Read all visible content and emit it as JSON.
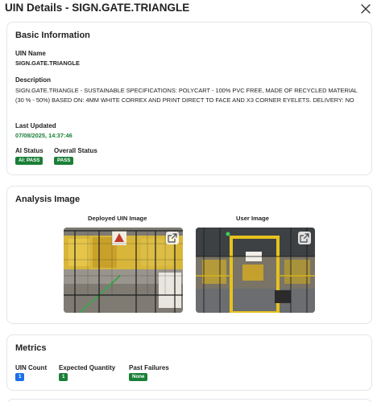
{
  "header": {
    "title": "UIN Details - SIGN.GATE.TRIANGLE"
  },
  "basic_info": {
    "title": "Basic Information",
    "uin_name_label": "UIN Name",
    "uin_name_value": "SIGN.GATE.TRIANGLE",
    "description_label": "Description",
    "description_value": "SIGN.GATE.TRIANGLE - SUSTAINABLE SPECIFICATIONS: POLYCART - 100% PVC FREE, MADE OF RECYCLED MATERIAL (30 % - 50%) BASED ON: 4MM WHITE CORREX AND PRINT DIRECT TO FACE AND X3 CORNER EYELETS. DELIVERY: NO",
    "last_updated_label": "Last Updated",
    "last_updated_value": "07/08/2025, 14:37:46",
    "ai_status_label": "AI Status",
    "ai_status_badge": "AI: PASS",
    "overall_status_label": "Overall Status",
    "overall_status_badge": "PASS"
  },
  "analysis": {
    "title": "Analysis Image",
    "deployed_caption": "Deployed UIN Image",
    "user_caption": "User Image"
  },
  "metrics": {
    "title": "Metrics",
    "uin_count_label": "UIN Count",
    "uin_count_value": "1",
    "expected_qty_label": "Expected Quantity",
    "expected_qty_value": "1",
    "past_failures_label": "Past Failures",
    "past_failures_value": "None"
  },
  "colors": {
    "status_green": "#1a7f37",
    "count_blue": "#1f6feb",
    "border": "#e2e5e9"
  },
  "icons": {
    "close": "close-icon",
    "external": "external-link-icon"
  }
}
